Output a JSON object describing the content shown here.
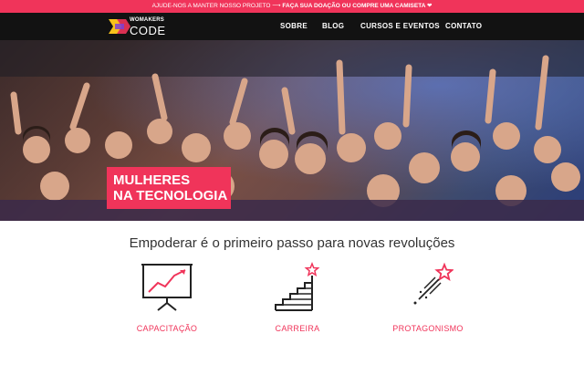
{
  "banner": {
    "text_prefix": "AJUDE-NOS A MANTER NOSSO PROJETO ⟶ ",
    "text_bold": "FAÇA SUA DOAÇÃO OU COMPRE UMA CAMISETA ",
    "heart": "❤"
  },
  "logo": {
    "line1": "WOMAKERS",
    "line2": "CODE",
    "colors": [
      "#f7c21c",
      "#f0345a",
      "#7b3fd6"
    ]
  },
  "nav": {
    "items": [
      {
        "label": "SOBRE"
      },
      {
        "label": "BLOG"
      },
      {
        "label": "CURSOS E EVENTOS"
      },
      {
        "label": "CONTATO"
      }
    ]
  },
  "hero": {
    "title_line1": "MULHERES",
    "title_line2": "NA TECNOLOGIA",
    "accent": "#f0345a"
  },
  "tagline": "Empoderar é o primeiro passo para novas revoluções",
  "features": [
    {
      "label": "CAPACITAÇÃO",
      "icon": "presentation-chart-icon"
    },
    {
      "label": "CARREIRA",
      "icon": "stairs-star-icon"
    },
    {
      "label": "PROTAGONISMO",
      "icon": "shooting-star-icon"
    }
  ]
}
